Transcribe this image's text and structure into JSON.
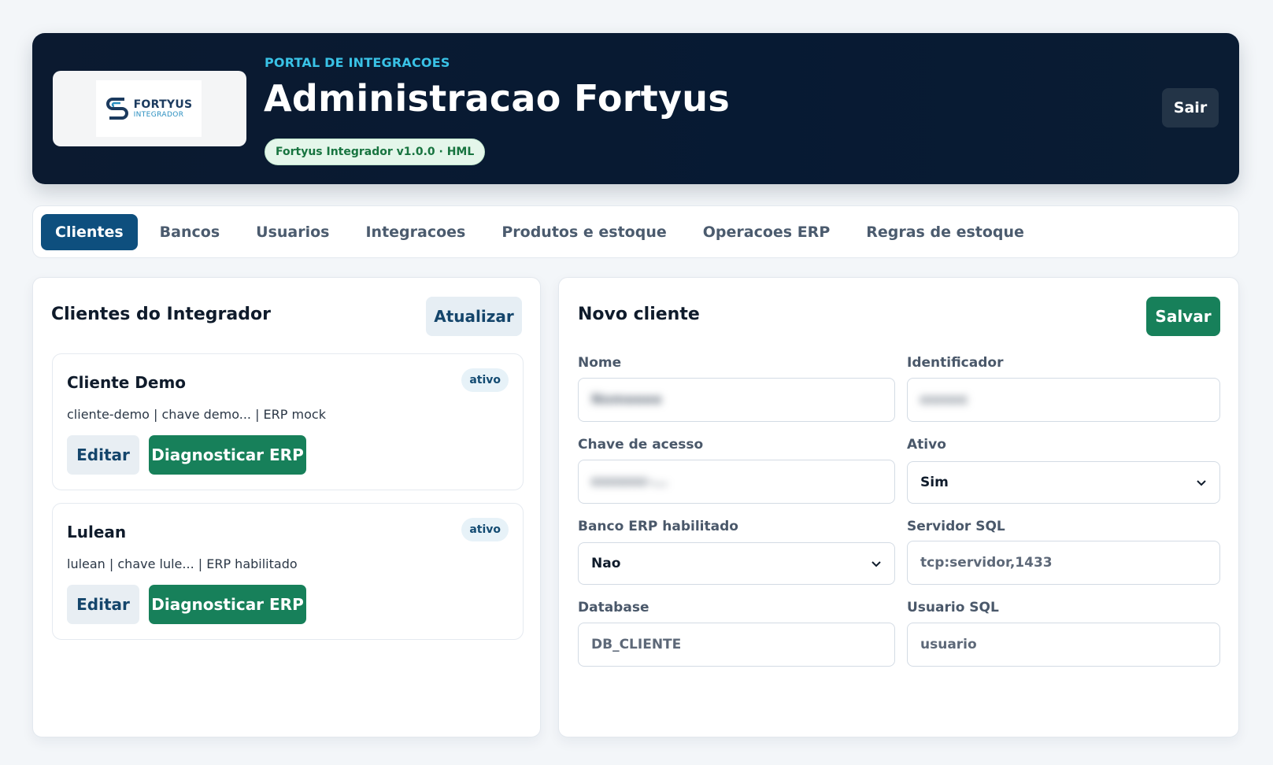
{
  "header": {
    "logo": {
      "line1": "FORTYUS",
      "line2": "INTEGRADOR"
    },
    "eyebrow": "PORTAL DE INTEGRACOES",
    "title": "Administracao Fortyus",
    "version": "Fortyus Integrador v1.0.0 · HML",
    "logout_label": "Sair"
  },
  "tabs": [
    {
      "label": "Clientes",
      "active": true
    },
    {
      "label": "Bancos"
    },
    {
      "label": "Usuarios"
    },
    {
      "label": "Integracoes"
    },
    {
      "label": "Produtos e estoque"
    },
    {
      "label": "Operacoes ERP"
    },
    {
      "label": "Regras de estoque"
    }
  ],
  "clients_panel": {
    "title": "Clientes do Integrador",
    "refresh_label": "Atualizar",
    "clients": [
      {
        "name": "Cliente Demo",
        "status": "ativo",
        "description": "cliente-demo | chave demo... | ERP mock",
        "edit_label": "Editar",
        "diagnose_label": "Diagnosticar ERP"
      },
      {
        "name": "Lulean",
        "status": "ativo",
        "description": "lulean | chave lule... | ERP habilitado",
        "edit_label": "Editar",
        "diagnose_label": "Diagnosticar ERP"
      }
    ]
  },
  "form_panel": {
    "title": "Novo cliente",
    "save_label": "Salvar",
    "fields": {
      "nome": {
        "label": "Nome",
        "value": "Nomeeee"
      },
      "identificador": {
        "label": "Identificador",
        "value": "cccccc"
      },
      "chave": {
        "label": "Chave de acesso",
        "value": "ccccccc-..."
      },
      "ativo": {
        "label": "Ativo",
        "value": "Sim"
      },
      "banco_erp": {
        "label": "Banco ERP habilitado",
        "value": "Nao"
      },
      "servidor_sql": {
        "label": "Servidor SQL",
        "placeholder": "tcp:servidor,1433"
      },
      "database": {
        "label": "Database",
        "placeholder": "DB_CLIENTE"
      },
      "usuario_sql": {
        "label": "Usuario SQL",
        "placeholder": "usuario"
      }
    }
  },
  "colors": {
    "header_bg": "#0b1a30",
    "accent_blue": "#0e4f7e",
    "accent_green": "#17805a",
    "eyebrow": "#39c2e6"
  }
}
